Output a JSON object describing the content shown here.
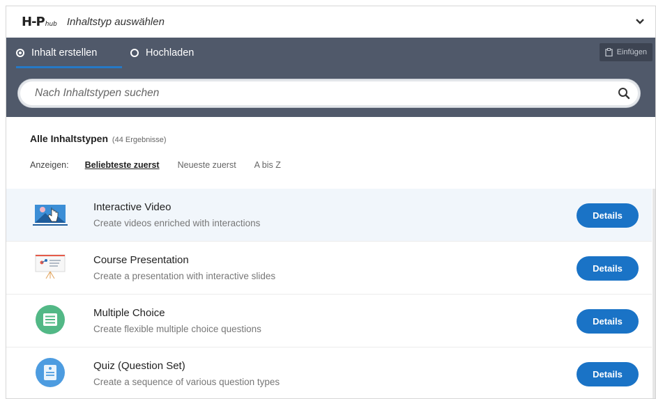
{
  "header": {
    "logo_main": "H-P",
    "logo_sub": "hub",
    "title": "Inhaltstyp auswählen"
  },
  "tabs": [
    {
      "label": "Inhalt erstellen",
      "selected": true
    },
    {
      "label": "Hochladen",
      "selected": false
    }
  ],
  "paste_button": {
    "label": "Einfügen",
    "icon": "clipboard-icon"
  },
  "search": {
    "placeholder": "Nach Inhaltstypen suchen",
    "value": ""
  },
  "filter": {
    "heading": "Alle Inhaltstypen",
    "count": "(44 Ergebnisse)",
    "sort_label": "Anzeigen:",
    "sort_options": [
      "Beliebteste zuerst",
      "Neueste zuerst",
      "A bis Z"
    ],
    "active_sort": "Beliebteste zuerst"
  },
  "content_types": [
    {
      "title": "Interactive Video",
      "description": "Create videos enriched with interactions",
      "button": "Details",
      "icon": "interactive-video-icon"
    },
    {
      "title": "Course Presentation",
      "description": "Create a presentation with interactive slides",
      "button": "Details",
      "icon": "course-presentation-icon"
    },
    {
      "title": "Multiple Choice",
      "description": "Create flexible multiple choice questions",
      "button": "Details",
      "icon": "multiple-choice-icon"
    },
    {
      "title": "Quiz (Question Set)",
      "description": "Create a sequence of various question types",
      "button": "Details",
      "icon": "question-set-icon"
    }
  ],
  "colors": {
    "bar": "#50596a",
    "accent": "#1a73c6",
    "highlight_row": "#f1f6fb"
  }
}
